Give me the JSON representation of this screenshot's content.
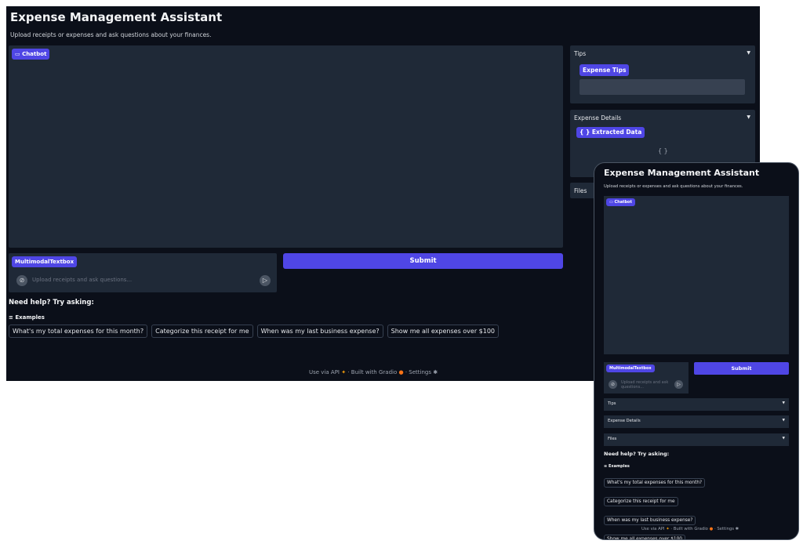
{
  "app": {
    "title": "Expense Management Assistant",
    "subtitle": "Upload receipts or expenses and ask questions about your finances."
  },
  "chatbot": {
    "label": "Chatbot",
    "icon": "chat-icon"
  },
  "input": {
    "label": "MultimodalTextbox",
    "placeholder": "Upload receipts and ask questions...",
    "attach_icon": "paperclip-icon",
    "send_icon": "send-icon"
  },
  "submit": {
    "label": "Submit"
  },
  "tips": {
    "title": "Tips",
    "button": "Expense Tips"
  },
  "details": {
    "title": "Expense Details",
    "label": "Extracted Data",
    "label_icon": "{ }",
    "json_value": "{ }"
  },
  "files": {
    "title": "Files"
  },
  "caret": "▼",
  "help": {
    "heading": "Need help? Try asking:"
  },
  "examples": {
    "heading": "Examples",
    "icon": "list-icon",
    "items": [
      "What's my total expenses for this month?",
      "Categorize this receipt for me",
      "When was my last business expense?",
      "Show me all expenses over $100"
    ]
  },
  "footer": {
    "api": "Use via API",
    "built": "Built with Gradio",
    "settings": "Settings",
    "sep": "·"
  },
  "colors": {
    "accent": "#4f46e5",
    "background": "#0b0f19",
    "panel": "#1f2937"
  }
}
